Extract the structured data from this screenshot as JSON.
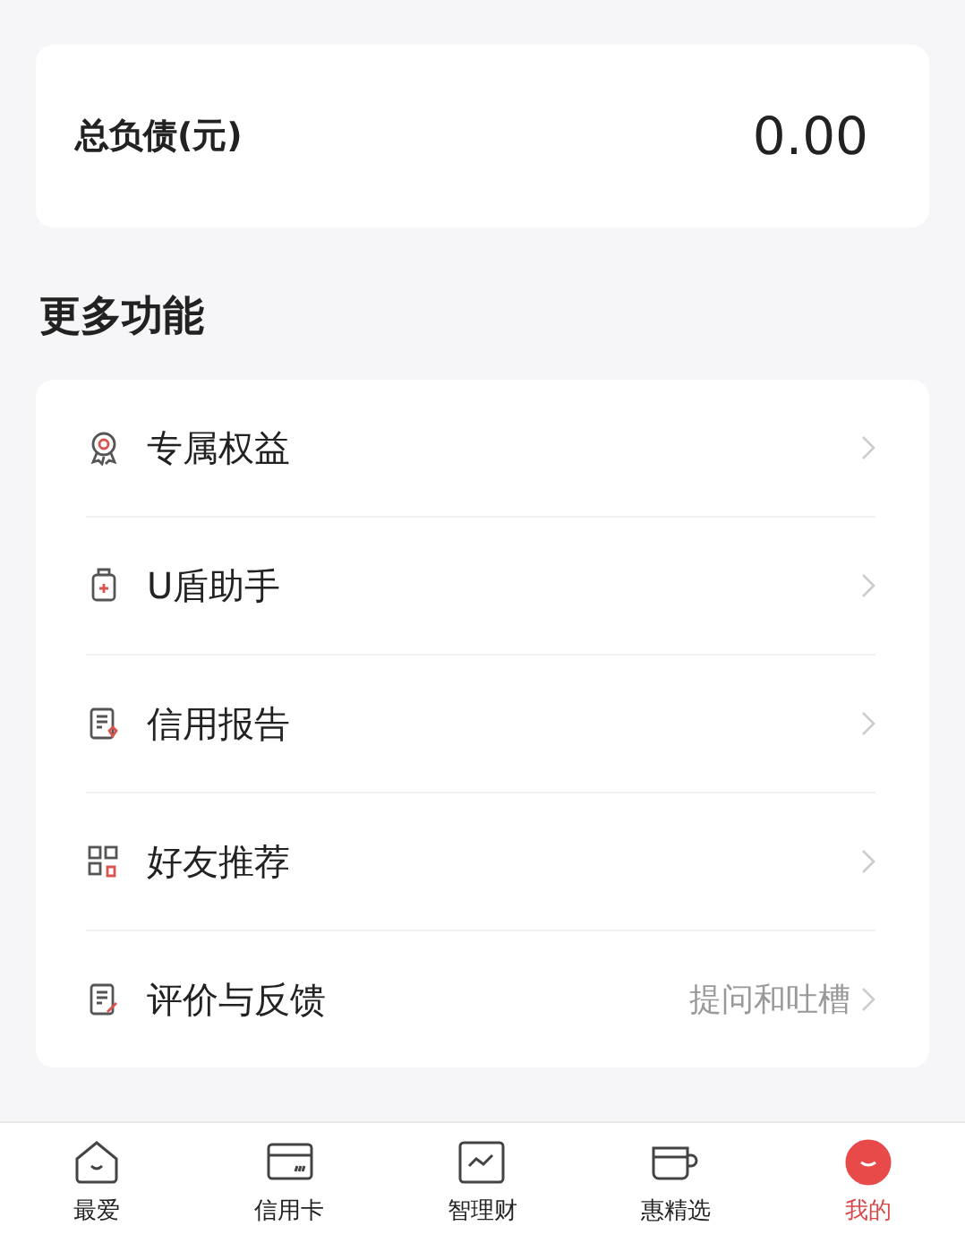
{
  "summary": {
    "label": "总负债(元)",
    "value": "0.00"
  },
  "section_title": "更多功能",
  "menu": [
    {
      "kind": "badge",
      "label": "专属权益"
    },
    {
      "kind": "usb",
      "label": "U盾助手"
    },
    {
      "kind": "report",
      "label": "信用报告"
    },
    {
      "kind": "qr",
      "label": "好友推荐"
    },
    {
      "kind": "feedback",
      "label": "评价与反馈",
      "hint": "提问和吐槽"
    }
  ],
  "tabs": [
    {
      "kind": "home",
      "label": "最爱",
      "selected": false
    },
    {
      "kind": "card",
      "label": "信用卡",
      "selected": false
    },
    {
      "kind": "chart",
      "label": "智理财",
      "selected": false
    },
    {
      "kind": "cup",
      "label": "惠精选",
      "selected": false
    },
    {
      "kind": "me",
      "label": "我的",
      "selected": true
    }
  ]
}
